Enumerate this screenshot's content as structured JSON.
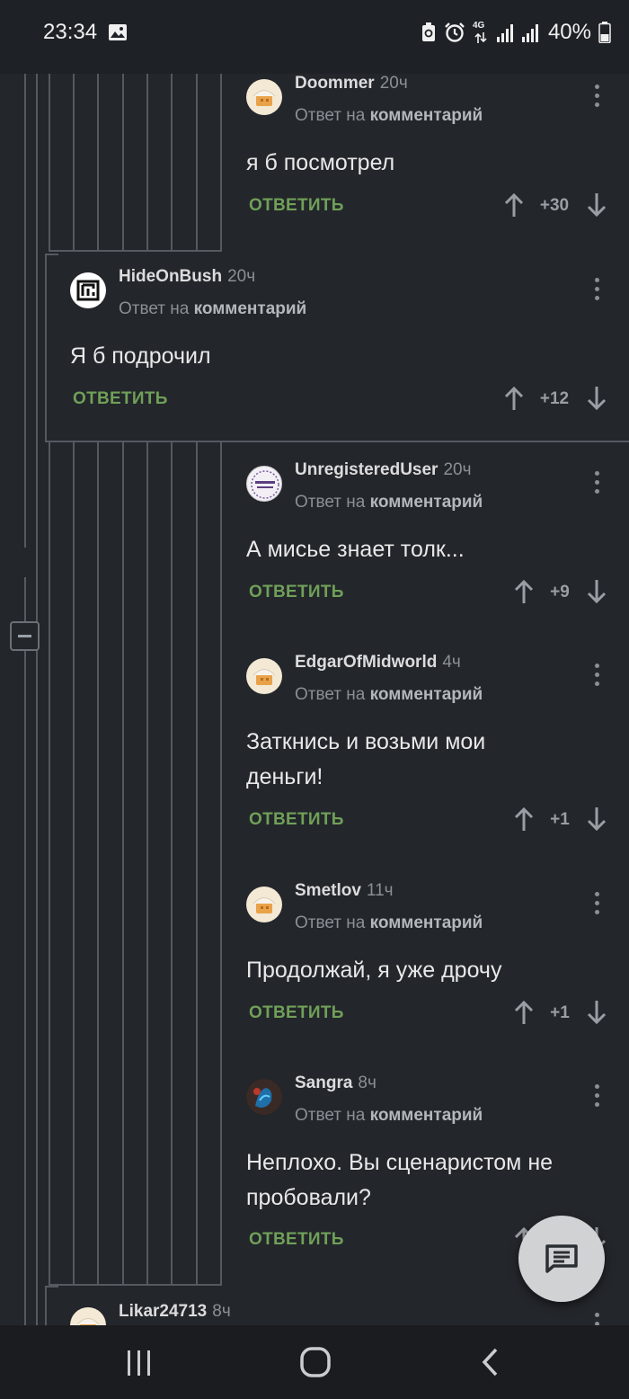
{
  "status": {
    "time": "23:34",
    "network": "4G",
    "battery": "40%"
  },
  "actions": {
    "reply_label": "ОТВЕТИТЬ"
  },
  "comments": [
    {
      "username": "Doommer",
      "time": "20ч",
      "reply_prefix": "Ответ на",
      "reply_target": "комментарий",
      "text_lines": [
        "я б посмотрел"
      ],
      "score": "+30"
    },
    {
      "username": "HideOnBush",
      "time": "20ч",
      "reply_prefix": "Ответ на",
      "reply_target": "комментарий",
      "text_lines": [
        "Я б подрочил"
      ],
      "score": "+12"
    },
    {
      "username": "UnregisteredUser",
      "time": "20ч",
      "reply_prefix": "Ответ на",
      "reply_target": "комментарий",
      "text_lines": [
        "А мисье знает толк..."
      ],
      "score": "+9"
    },
    {
      "username": "EdgarOfMidworld",
      "time": "4ч",
      "reply_prefix": "Ответ на",
      "reply_target": "комментарий",
      "text_lines": [
        "Заткнись и возьми мои",
        "деньги!"
      ],
      "score": "+1"
    },
    {
      "username": "Smetlov",
      "time": "11ч",
      "reply_prefix": "Ответ на",
      "reply_target": "комментарий",
      "text_lines": [
        "Продолжай, я уже дрочу"
      ],
      "score": "+1"
    },
    {
      "username": "Sangra",
      "time": "8ч",
      "reply_prefix": "Ответ на",
      "reply_target": "комментарий",
      "text_lines": [
        "Неплохо. Вы сценаристом не",
        "пробовали?"
      ]
    },
    {
      "username": "Likar24713",
      "time": "8ч"
    }
  ],
  "colors": {
    "background": "#23262b",
    "reply_green": "#70a058",
    "thread_line": "#555a61"
  }
}
